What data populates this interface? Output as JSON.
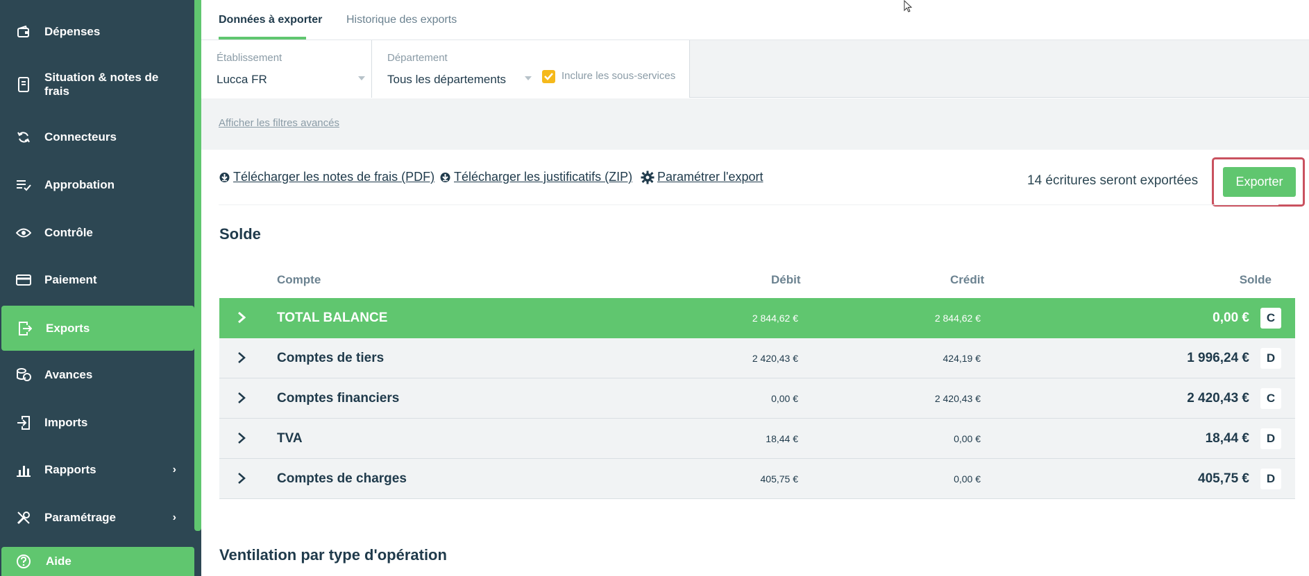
{
  "sidebar": {
    "items": [
      {
        "label": "Dépenses",
        "icon": "wallet-icon"
      },
      {
        "label": "Situation & notes de frais",
        "icon": "receipt-icon"
      },
      {
        "label": "Connecteurs",
        "icon": "sync-icon"
      },
      {
        "label": "Approbation",
        "icon": "checklist-icon"
      },
      {
        "label": "Contrôle",
        "icon": "eye-icon"
      },
      {
        "label": "Paiement",
        "icon": "credit-card-icon"
      },
      {
        "label": "Exports",
        "icon": "export-icon",
        "active": true
      },
      {
        "label": "Avances",
        "icon": "coins-icon"
      },
      {
        "label": "Imports",
        "icon": "import-icon"
      },
      {
        "label": "Rapports",
        "icon": "bar-chart-icon",
        "expandable": true
      },
      {
        "label": "Paramétrage",
        "icon": "tools-icon",
        "expandable": true
      }
    ],
    "help": {
      "label": "Aide",
      "icon": "help-icon"
    }
  },
  "tabs": [
    {
      "label": "Données à exporter",
      "active": true
    },
    {
      "label": "Historique des exports",
      "active": false
    }
  ],
  "filters": {
    "establishment": {
      "label": "Établissement",
      "value": "Lucca FR"
    },
    "department": {
      "label": "Département",
      "value": "Tous les départements"
    },
    "include_subservices": {
      "label": "Inclure les sous-services",
      "checked": true
    },
    "advanced_link": "Afficher les filtres avancés"
  },
  "actions": {
    "download_pdf": "Télécharger les notes de frais (PDF)",
    "download_zip": "Télécharger les justificatifs (ZIP)",
    "configure": "Paramétrer l'export",
    "count_text": "14 écritures seront exportées",
    "export_button": "Exporter"
  },
  "balance": {
    "title": "Solde",
    "columns": {
      "account": "Compte",
      "debit": "Débit",
      "credit": "Crédit",
      "balance": "Solde"
    },
    "rows": [
      {
        "account": "TOTAL BALANCE",
        "debit": "2 844,62 €",
        "credit": "2 844,62 €",
        "balance": "0,00 €",
        "side": "C"
      },
      {
        "account": "Comptes de tiers",
        "debit": "2 420,43 €",
        "credit": "424,19 €",
        "balance": "1 996,24 €",
        "side": "D"
      },
      {
        "account": "Comptes financiers",
        "debit": "0,00 €",
        "credit": "2 420,43 €",
        "balance": "2 420,43 €",
        "side": "C"
      },
      {
        "account": "TVA",
        "debit": "18,44 €",
        "credit": "0,00 €",
        "balance": "18,44 €",
        "side": "D"
      },
      {
        "account": "Comptes de charges",
        "debit": "405,75 €",
        "credit": "0,00 €",
        "balance": "405,75 €",
        "side": "D"
      }
    ]
  },
  "breakdown": {
    "title": "Ventilation par type d'opération"
  },
  "colors": {
    "sidebar": "#2d4753",
    "accent": "#60c66f",
    "highlight_outline": "#c9515f",
    "checkbox": "#f5b91b"
  }
}
